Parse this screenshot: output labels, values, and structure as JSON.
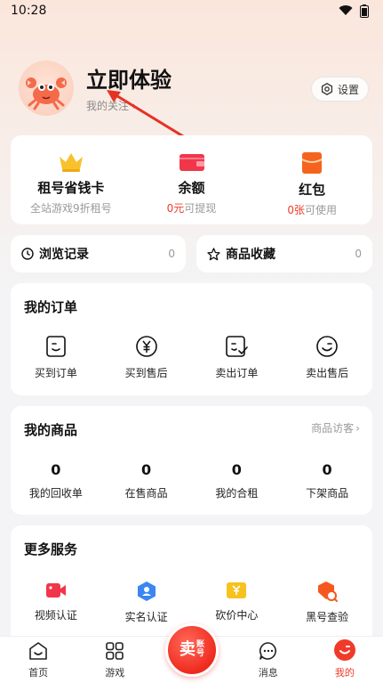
{
  "status_bar": {
    "time": "10:28"
  },
  "profile": {
    "username": "立即体验",
    "follow_label": "我的关注",
    "settings_label": "设置"
  },
  "wallet": [
    {
      "title": "租号省钱卡",
      "sub": "全站游戏9折租号",
      "icon": "crown-icon"
    },
    {
      "title": "余额",
      "sub_highlight": "0元",
      "sub": "可提现",
      "icon": "wallet-icon"
    },
    {
      "title": "红包",
      "sub_highlight": "0张",
      "sub": "可使用",
      "icon": "red-packet-icon"
    }
  ],
  "quick_links": [
    {
      "label": "浏览记录",
      "count": "0",
      "icon": "clock-icon"
    },
    {
      "label": "商品收藏",
      "count": "0",
      "icon": "star-icon"
    }
  ],
  "orders": {
    "title": "我的订单",
    "items": [
      {
        "label": "买到订单",
        "icon": "bought-order-icon"
      },
      {
        "label": "买到售后",
        "icon": "yen-aftersale-icon"
      },
      {
        "label": "卖出订单",
        "icon": "sold-order-icon"
      },
      {
        "label": "卖出售后",
        "icon": "sold-aftersale-icon"
      }
    ]
  },
  "products": {
    "title": "我的商品",
    "visitor_link": "商品访客",
    "items": [
      {
        "value": "0",
        "label": "我的回收单"
      },
      {
        "value": "0",
        "label": "在售商品"
      },
      {
        "value": "0",
        "label": "我的合租"
      },
      {
        "value": "0",
        "label": "下架商品"
      }
    ]
  },
  "services": {
    "title": "更多服务",
    "items": [
      {
        "label": "视频认证",
        "icon": "video-icon"
      },
      {
        "label": "实名认证",
        "icon": "id-verify-icon"
      },
      {
        "label": "砍价中心",
        "icon": "bargain-icon"
      },
      {
        "label": "黑号查验",
        "icon": "blacklist-check-icon"
      }
    ]
  },
  "tabbar": {
    "items": [
      {
        "label": "首页",
        "icon": "home-icon"
      },
      {
        "label": "游戏",
        "icon": "grid-icon"
      },
      {
        "label": "消息",
        "icon": "message-icon"
      },
      {
        "label": "我的",
        "icon": "profile-icon"
      }
    ],
    "sell_main": "卖",
    "sell_side_1": "账",
    "sell_side_2": "号"
  },
  "colors": {
    "accent": "#f03b2a",
    "muted": "#9a9a9a"
  }
}
